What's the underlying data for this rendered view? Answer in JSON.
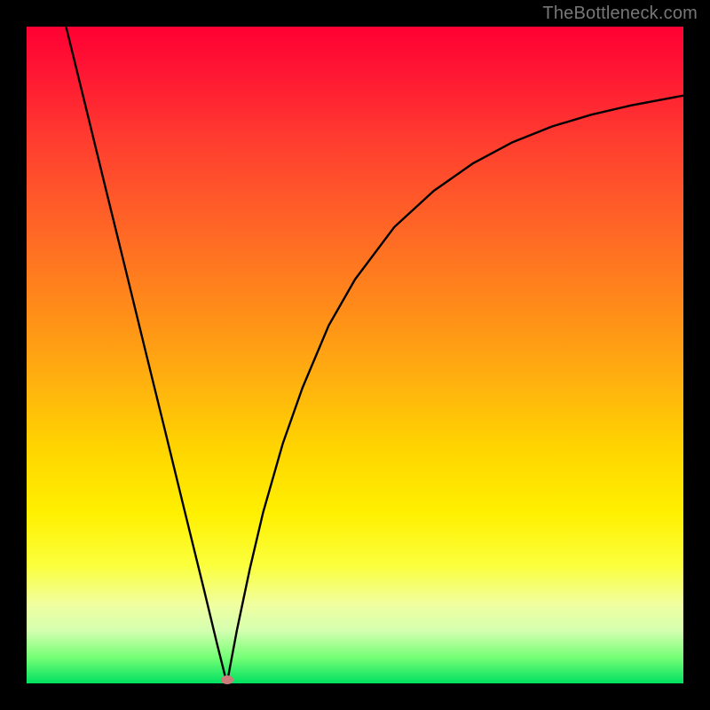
{
  "watermark": "TheBottleneck.com",
  "marker": {
    "x_frac": 0.305,
    "y_frac": 0.995,
    "color": "#cd7b7b"
  },
  "chart_data": {
    "type": "line",
    "title": "",
    "xlabel": "",
    "ylabel": "",
    "xlim": [
      0,
      1
    ],
    "ylim": [
      0,
      1
    ],
    "grid": false,
    "background_gradient": {
      "direction": "vertical",
      "stops": [
        {
          "pos": 0.0,
          "color": "#ff0033"
        },
        {
          "pos": 0.32,
          "color": "#ff6a25"
        },
        {
          "pos": 0.64,
          "color": "#ffd400"
        },
        {
          "pos": 0.85,
          "color": "#f5ff80"
        },
        {
          "pos": 1.0,
          "color": "#00e060"
        }
      ]
    },
    "series": [
      {
        "name": "left-branch",
        "x": [
          0.06,
          0.09,
          0.12,
          0.15,
          0.18,
          0.21,
          0.24,
          0.27,
          0.29,
          0.305
        ],
        "y": [
          1.0,
          0.878,
          0.755,
          0.633,
          0.51,
          0.388,
          0.265,
          0.143,
          0.06,
          0.0
        ]
      },
      {
        "name": "right-branch",
        "x": [
          0.305,
          0.32,
          0.34,
          0.36,
          0.39,
          0.42,
          0.46,
          0.5,
          0.56,
          0.62,
          0.68,
          0.74,
          0.8,
          0.86,
          0.92,
          1.0
        ],
        "y": [
          0.0,
          0.08,
          0.175,
          0.26,
          0.365,
          0.45,
          0.545,
          0.615,
          0.695,
          0.75,
          0.792,
          0.824,
          0.848,
          0.866,
          0.88,
          0.895
        ]
      }
    ],
    "annotations": [
      {
        "type": "marker",
        "x": 0.305,
        "y": 0.005,
        "color": "#cd7b7b",
        "shape": "ellipse"
      }
    ]
  }
}
